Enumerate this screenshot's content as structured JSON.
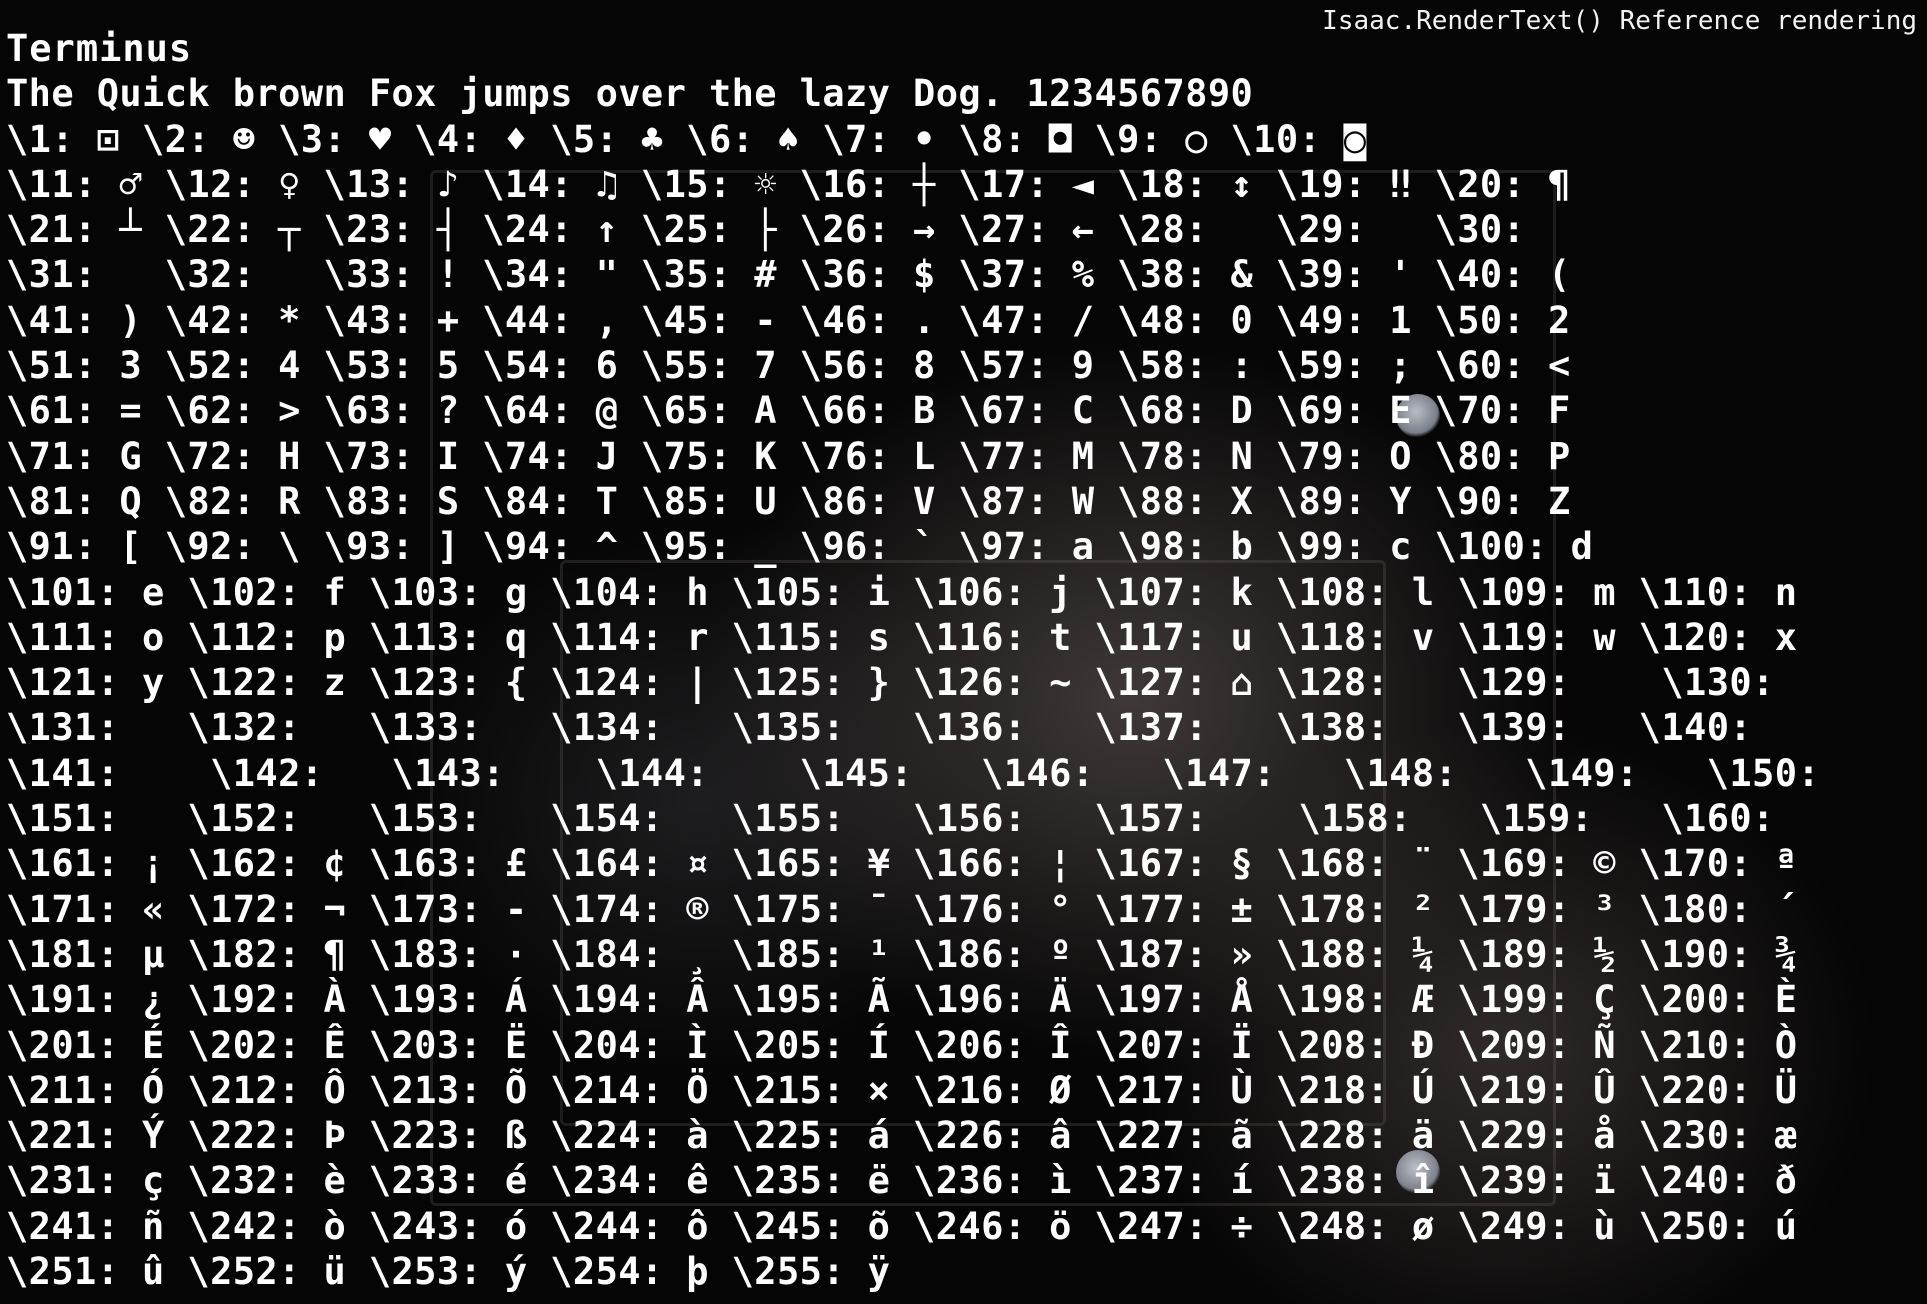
{
  "header": {
    "title": "Isaac.RenderText() Reference rendering"
  },
  "font_name": "Terminus",
  "sample_text": "The Quick brown Fox jumps over the lazy Dog. 1234567890",
  "rows": [
    "\\1: ⊡ \\2: ☻ \\3: ♥ \\4: ♦ \\5: ♣ \\6: ♠ \\7: • \\8: ◘ \\9: ○ \\10: ◙",
    "\\11: ♂ \\12: ♀ \\13: ♪ \\14: ♫ \\15: ☼ \\16: ┼ \\17: ◄ \\18: ↕ \\19: ‼ \\20: ¶",
    "\\21: ┴ \\22: ┬ \\23: ┤ \\24: ↑ \\25: ├ \\26: → \\27: ← \\28:   \\29:   \\30:",
    "\\31:   \\32:   \\33: ! \\34: \" \\35: # \\36: $ \\37: % \\38: & \\39: ' \\40: (",
    "\\41: ) \\42: * \\43: + \\44: , \\45: - \\46: . \\47: / \\48: 0 \\49: 1 \\50: 2",
    "\\51: 3 \\52: 4 \\53: 5 \\54: 6 \\55: 7 \\56: 8 \\57: 9 \\58: : \\59: ; \\60: <",
    "\\61: = \\62: > \\63: ? \\64: @ \\65: A \\66: B \\67: C \\68: D \\69: E \\70: F",
    "\\71: G \\72: H \\73: I \\74: J \\75: K \\76: L \\77: M \\78: N \\79: O \\80: P",
    "\\81: Q \\82: R \\83: S \\84: T \\85: U \\86: V \\87: W \\88: X \\89: Y \\90: Z",
    "\\91: [ \\92: \\ \\93: ] \\94: ^ \\95: _ \\96: ` \\97: a \\98: b \\99: c \\100: d",
    "\\101: e \\102: f \\103: g \\104: h \\105: i \\106: j \\107: k \\108: l \\109: m \\110: n",
    "\\111: o \\112: p \\113: q \\114: r \\115: s \\116: t \\117: u \\118: v \\119: w \\120: x",
    "\\121: y \\122: z \\123: { \\124: | \\125: } \\126: ~ \\127: ⌂ \\128:   \\129:    \\130:",
    "\\131:   \\132:   \\133:   \\134:   \\135:   \\136:   \\137:   \\138:   \\139:   \\140:",
    "\\141:    \\142:   \\143:    \\144:    \\145:   \\146:   \\147:   \\148:   \\149:   \\150:",
    "\\151:   \\152:   \\153:   \\154:   \\155:   \\156:   \\157:    \\158:   \\159:   \\160:",
    "\\161: ¡ \\162: ¢ \\163: £ \\164: ¤ \\165: ¥ \\166: ¦ \\167: § \\168: ¨ \\169: © \\170: ª",
    "\\171: « \\172: ¬ \\173: - \\174: ® \\175: ¯ \\176: ° \\177: ± \\178: ² \\179: ³ \\180: ´",
    "\\181: µ \\182: ¶ \\183: · \\184: ¸ \\185: ¹ \\186: º \\187: » \\188: ¼ \\189: ½ \\190: ¾",
    "\\191: ¿ \\192: À \\193: Á \\194: Â \\195: Ã \\196: Ä \\197: Å \\198: Æ \\199: Ç \\200: È",
    "\\201: É \\202: Ê \\203: Ë \\204: Ì \\205: Í \\206: Î \\207: Ï \\208: Ð \\209: Ñ \\210: Ò",
    "\\211: Ó \\212: Ô \\213: Õ \\214: Ö \\215: × \\216: Ø \\217: Ù \\218: Ú \\219: Û \\220: Ü",
    "\\221: Ý \\222: Þ \\223: ß \\224: à \\225: á \\226: â \\227: ã \\228: ä \\229: å \\230: æ",
    "\\231: ç \\232: è \\233: é \\234: ê \\235: ë \\236: ì \\237: í \\238: î \\239: ï \\240: ð",
    "\\241: ñ \\242: ò \\243: ó \\244: ô \\245: õ \\246: ö \\247: ÷ \\248: ø \\249: ù \\250: ú",
    "\\251: û \\252: ü \\253: ý \\254: þ \\255: ÿ"
  ]
}
